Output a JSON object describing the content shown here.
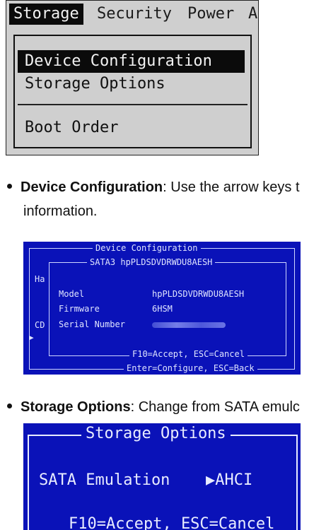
{
  "menu_screenshot": {
    "tabs": [
      "Storage",
      "Security",
      "Power",
      "A"
    ],
    "active_tab": "Storage",
    "items": [
      "Device Configuration",
      "Storage Options",
      "Boot Order"
    ]
  },
  "bullets": [
    {
      "term": "Device Configuration",
      "text": ": Use the arrow keys t",
      "continuation": "information."
    },
    {
      "term": "Storage Options",
      "text": ": Change from SATA emulc"
    }
  ],
  "device_config_dialog": {
    "title": "Device Configuration",
    "subtitle": "SATA3  hpPLDSDVDRWDU8AESH",
    "side_labels": [
      "Ha",
      "CD",
      "▶"
    ],
    "fields": [
      {
        "label": "Model",
        "value": "hpPLDSDVDRWDU8AESH"
      },
      {
        "label": "Firmware",
        "value": "6HSM"
      },
      {
        "label": "Serial Number",
        "value": ""
      }
    ],
    "inner_footer": "F10=Accept, ESC=Cancel",
    "outer_footer": "Enter=Configure, ESC=Back"
  },
  "storage_options_dialog": {
    "title": "Storage Options",
    "option_label": "SATA Emulation",
    "option_value": "▶AHCI",
    "footer": "F10=Accept, ESC=Cancel"
  }
}
